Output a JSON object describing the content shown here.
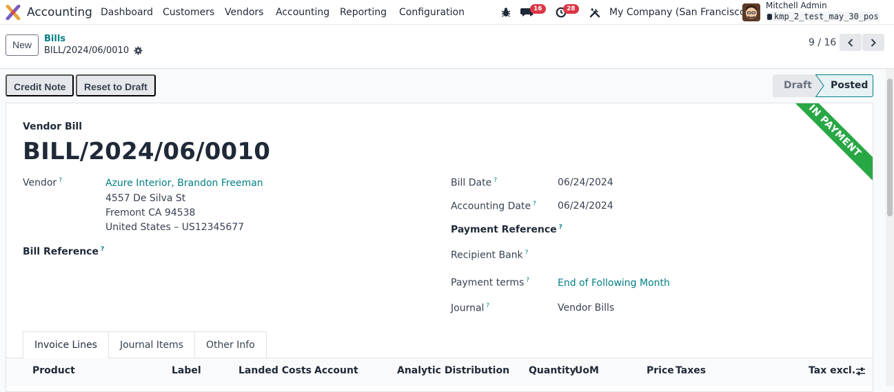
{
  "navbar": {
    "app_name": "Accounting",
    "menu": [
      "Dashboard",
      "Customers",
      "Vendors",
      "Accounting",
      "Reporting",
      "Configuration"
    ],
    "messages_count": "16",
    "activities_count": "28",
    "company": "My Company (San Francisco)",
    "user_name": "Mitchell Admin",
    "database": "kmp_2_test_may_30_pos"
  },
  "control": {
    "new_label": "New",
    "breadcrumb_parent": "Bills",
    "breadcrumb_current": "BILL/2024/06/0010",
    "pager": "9 / 16"
  },
  "actions": {
    "credit_note": "Credit Note",
    "reset_to_draft": "Reset to Draft"
  },
  "status": {
    "draft": "Draft",
    "posted": "Posted",
    "ribbon": "IN PAYMENT"
  },
  "form": {
    "doc_type": "Vendor Bill",
    "title": "BILL/2024/06/0010",
    "help_mark": "?",
    "vendor_label": "Vendor",
    "vendor_name": "Azure Interior, Brandon Freeman",
    "vendor_address": [
      "4557 De Silva St",
      "Fremont CA 94538",
      "United States – US12345677"
    ],
    "bill_reference_label": "Bill Reference",
    "bill_date_label": "Bill Date",
    "bill_date": "06/24/2024",
    "accounting_date_label": "Accounting Date",
    "accounting_date": "06/24/2024",
    "payment_reference_label": "Payment Reference",
    "recipient_bank_label": "Recipient Bank",
    "payment_terms_label": "Payment terms",
    "payment_terms": "End of Following Month",
    "journal_label": "Journal",
    "journal": "Vendor Bills"
  },
  "tabs": [
    "Invoice Lines",
    "Journal Items",
    "Other Info"
  ],
  "table_headers": [
    "Product",
    "Label",
    "Landed Costs",
    "Account",
    "Analytic Distribution",
    "Quantity",
    "UoM",
    "Price",
    "Taxes",
    "Tax excl."
  ],
  "colors": {
    "primary": "#017e84",
    "ribbon": "#28a745",
    "badge": "#dc3545"
  }
}
